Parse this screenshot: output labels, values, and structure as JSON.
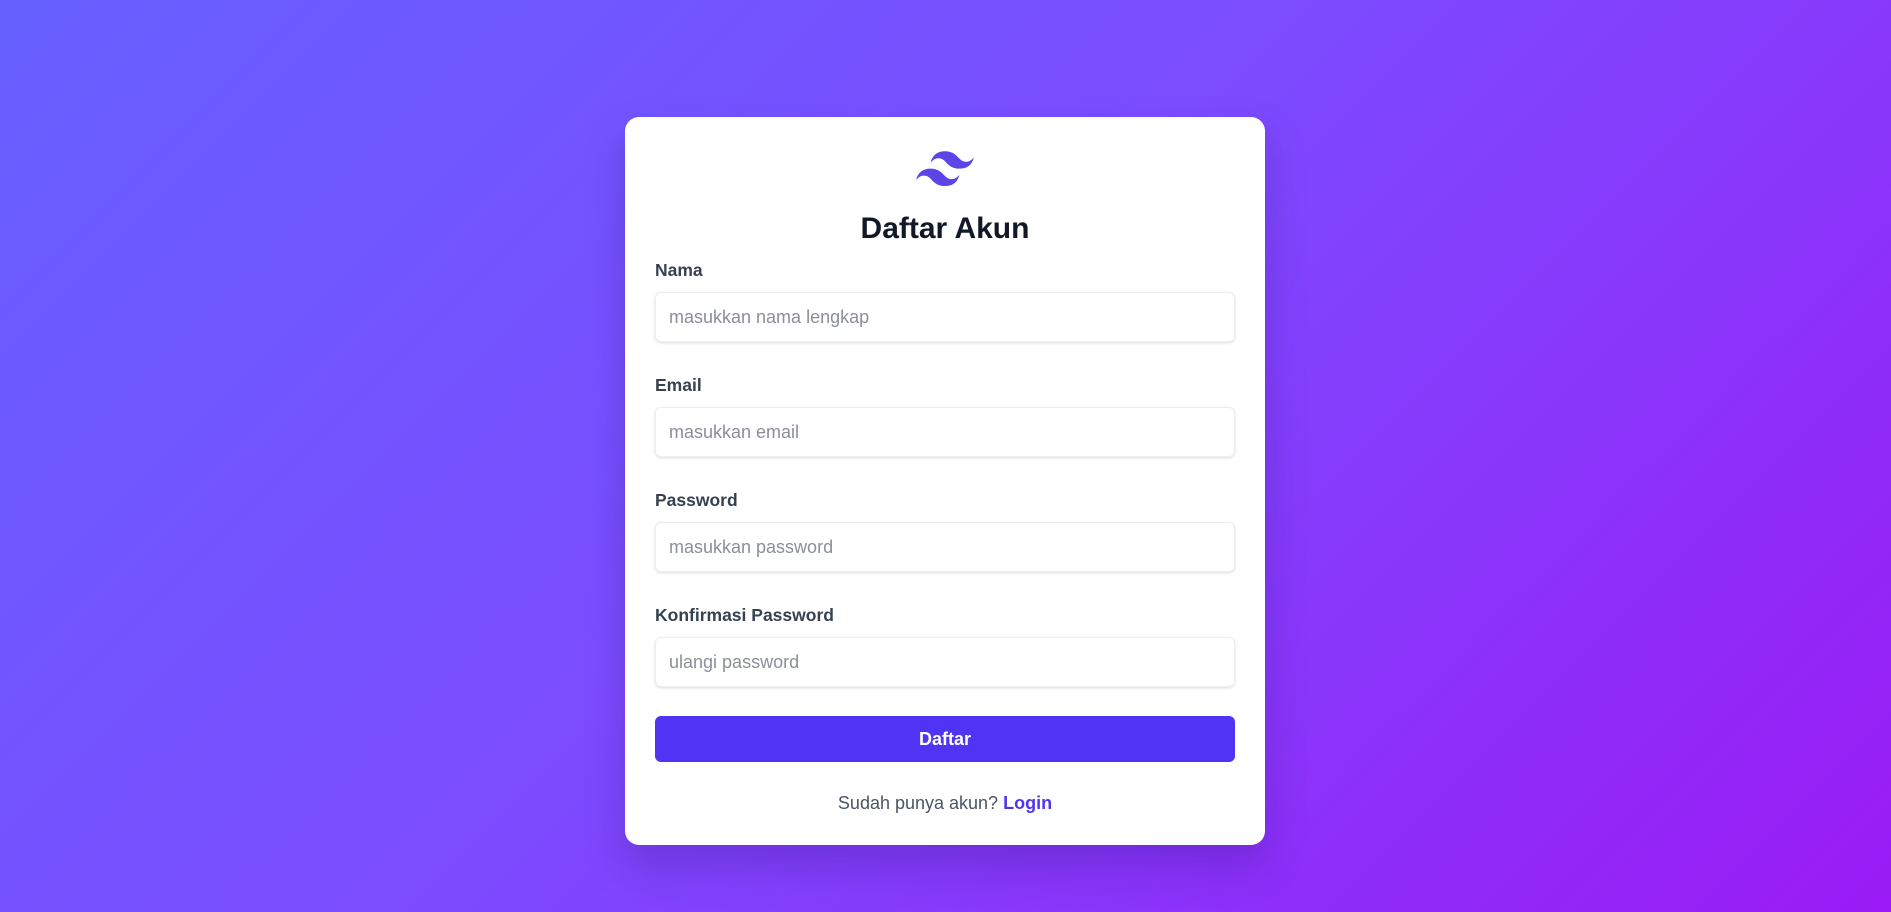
{
  "app": {
    "logo_icon": "tailwind-waves-icon",
    "title": "Daftar Akun"
  },
  "form": {
    "fields": [
      {
        "label": "Nama",
        "placeholder": "masukkan nama lengkap",
        "value": ""
      },
      {
        "label": "Email",
        "placeholder": "masukkan email",
        "value": ""
      },
      {
        "label": "Password",
        "placeholder": "masukkan password",
        "value": ""
      },
      {
        "label": "Konfirmasi Password",
        "placeholder": "ulangi password",
        "value": ""
      }
    ],
    "submit_label": "Daftar"
  },
  "footer": {
    "prompt": "Sudah punya akun?",
    "link_label": "Login"
  },
  "colors": {
    "accent": "#4f34f4",
    "background_start": "#6660ff",
    "background_end": "#9a1bf5",
    "card": "#ffffff"
  }
}
